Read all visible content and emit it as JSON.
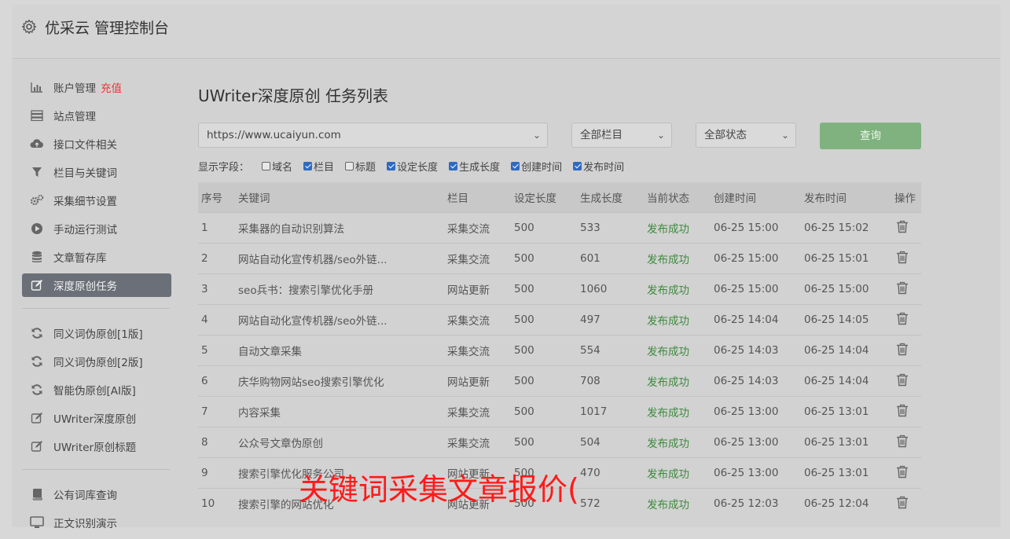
{
  "header": {
    "title": "优采云 管理控制台",
    "icon": "gear-icon"
  },
  "sidebar": {
    "group1": [
      {
        "label": "账户管理",
        "badge": "充值",
        "icon": "bar-chart-icon"
      },
      {
        "label": "站点管理",
        "icon": "server-icon"
      },
      {
        "label": "接口文件相关",
        "icon": "cloud-upload-icon"
      },
      {
        "label": "栏目与关键词",
        "icon": "filter-icon"
      },
      {
        "label": "采集细节设置",
        "icon": "gears-icon"
      },
      {
        "label": "手动运行测试",
        "icon": "play-circle-icon"
      },
      {
        "label": "文章暂存库",
        "icon": "database-icon"
      },
      {
        "label": "深度原创任务",
        "icon": "edit-icon",
        "active": true
      }
    ],
    "group2": [
      {
        "label": "同义词伪原创[1版]",
        "icon": "refresh-icon"
      },
      {
        "label": "同义词伪原创[2版]",
        "icon": "refresh-icon"
      },
      {
        "label": "智能伪原创[AI版]",
        "icon": "refresh-icon"
      },
      {
        "label": "UWriter深度原创",
        "icon": "edit-icon"
      },
      {
        "label": "UWriter原创标题",
        "icon": "edit-icon"
      }
    ],
    "group3": [
      {
        "label": "公有词库查询",
        "icon": "book-icon"
      },
      {
        "label": "正文识别演示",
        "icon": "monitor-icon"
      }
    ]
  },
  "main": {
    "title": "UWriter深度原创 任务列表",
    "site_select": "https://www.ucaiyun.com",
    "column_select": "全部栏目",
    "status_select": "全部状态",
    "query_button": "查询",
    "fields_label": "显示字段：",
    "fields": [
      {
        "label": "域名",
        "checked": false
      },
      {
        "label": "栏目",
        "checked": true
      },
      {
        "label": "标题",
        "checked": false
      },
      {
        "label": "设定长度",
        "checked": true
      },
      {
        "label": "生成长度",
        "checked": true
      },
      {
        "label": "创建时间",
        "checked": true
      },
      {
        "label": "发布时间",
        "checked": true
      }
    ],
    "columns": [
      "序号",
      "关键词",
      "栏目",
      "设定长度",
      "生成长度",
      "当前状态",
      "创建时间",
      "发布时间",
      "操作"
    ],
    "rows": [
      [
        "1",
        "采集器的自动识别算法",
        "采集交流",
        "500",
        "533",
        "发布成功",
        "06-25 15:00",
        "06-25 15:02"
      ],
      [
        "2",
        "网站自动化宣传机器/seo外链...",
        "采集交流",
        "500",
        "601",
        "发布成功",
        "06-25 15:00",
        "06-25 15:01"
      ],
      [
        "3",
        "seo兵书：搜索引擎优化手册",
        "网站更新",
        "500",
        "1060",
        "发布成功",
        "06-25 15:00",
        "06-25 15:00"
      ],
      [
        "4",
        "网站自动化宣传机器/seo外链...",
        "采集交流",
        "500",
        "497",
        "发布成功",
        "06-25 14:04",
        "06-25 14:05"
      ],
      [
        "5",
        "自动文章采集",
        "采集交流",
        "500",
        "554",
        "发布成功",
        "06-25 14:03",
        "06-25 14:04"
      ],
      [
        "6",
        "庆华购物网站seo搜索引擎优化",
        "网站更新",
        "500",
        "708",
        "发布成功",
        "06-25 14:03",
        "06-25 14:04"
      ],
      [
        "7",
        "内容采集",
        "采集交流",
        "500",
        "1017",
        "发布成功",
        "06-25 13:00",
        "06-25 13:01"
      ],
      [
        "8",
        "公众号文章伪原创",
        "采集交流",
        "500",
        "504",
        "发布成功",
        "06-25 13:00",
        "06-25 13:01"
      ],
      [
        "9",
        "搜索引擎优化服务公司",
        "网站更新",
        "500",
        "470",
        "发布成功",
        "06-25 13:00",
        "06-25 13:01"
      ],
      [
        "10",
        "搜索引擎的网站优化",
        "网站更新",
        "500",
        "572",
        "发布成功",
        "06-25 12:03",
        "06-25 12:04"
      ]
    ]
  },
  "overlay_caption": "关键词采集文章报价(",
  "colors": {
    "active_nav": "#6a6f78",
    "query_button": "#7fb27f",
    "status_ok": "#3c8a3c",
    "badge_red": "#e53935",
    "caption_red": "#ff1a1a"
  }
}
